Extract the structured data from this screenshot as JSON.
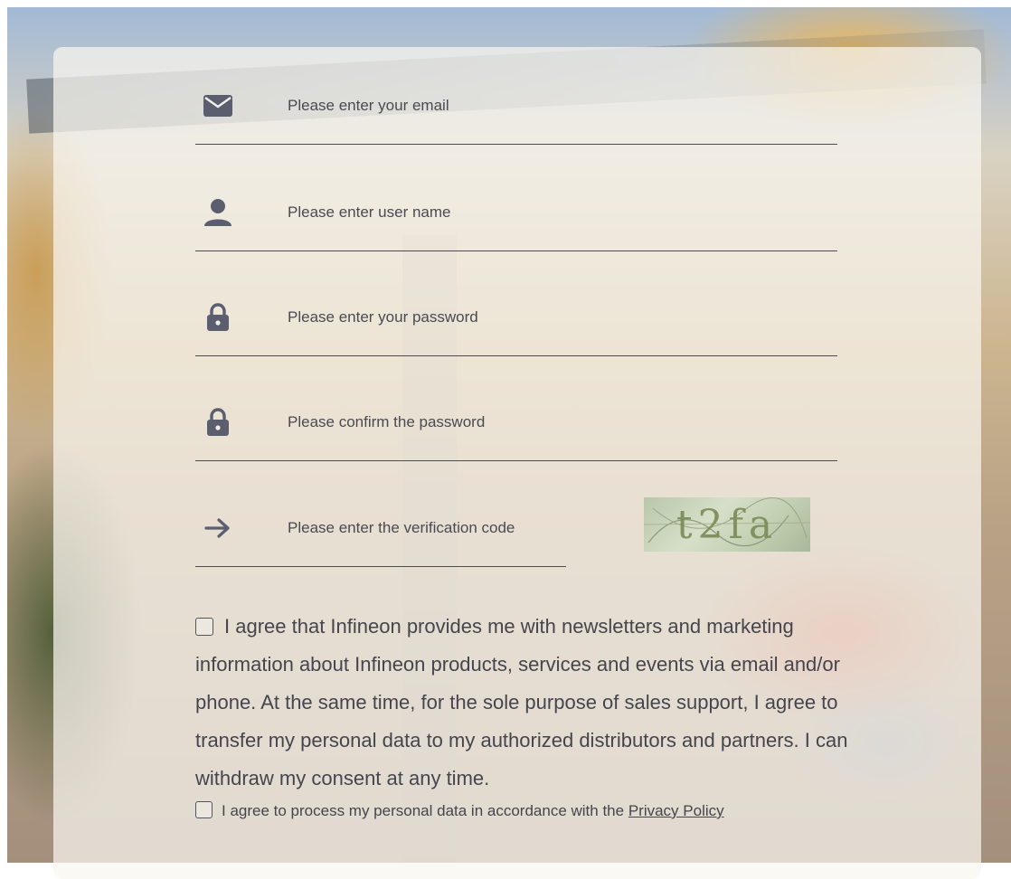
{
  "form": {
    "fields": [
      {
        "icon": "envelope-icon",
        "placeholder": "Please enter your email"
      },
      {
        "icon": "user-icon",
        "placeholder": "Please enter user name"
      },
      {
        "icon": "lock-icon",
        "placeholder": "Please enter your password"
      },
      {
        "icon": "lock-icon",
        "placeholder": "Please confirm the password"
      },
      {
        "icon": "arrow-right-icon",
        "placeholder": "Please enter the verification code"
      }
    ],
    "captcha": {
      "text": "t2fa"
    },
    "consent_marketing": {
      "checked": false,
      "text": "I agree that Infineon provides me with newsletters and marketing information about Infineon products, services and events via email and/or phone. At the same time, for the sole purpose of sales support, I agree to transfer my personal data to my authorized distributors and partners. I can withdraw my consent at any time."
    },
    "consent_privacy": {
      "checked": false,
      "text": "I agree to process my personal data in accordance with the",
      "link_text": "Privacy Policy"
    }
  },
  "colors": {
    "icon": "#5b5e6e",
    "text": "#45454d",
    "line": "#4b4b52"
  }
}
